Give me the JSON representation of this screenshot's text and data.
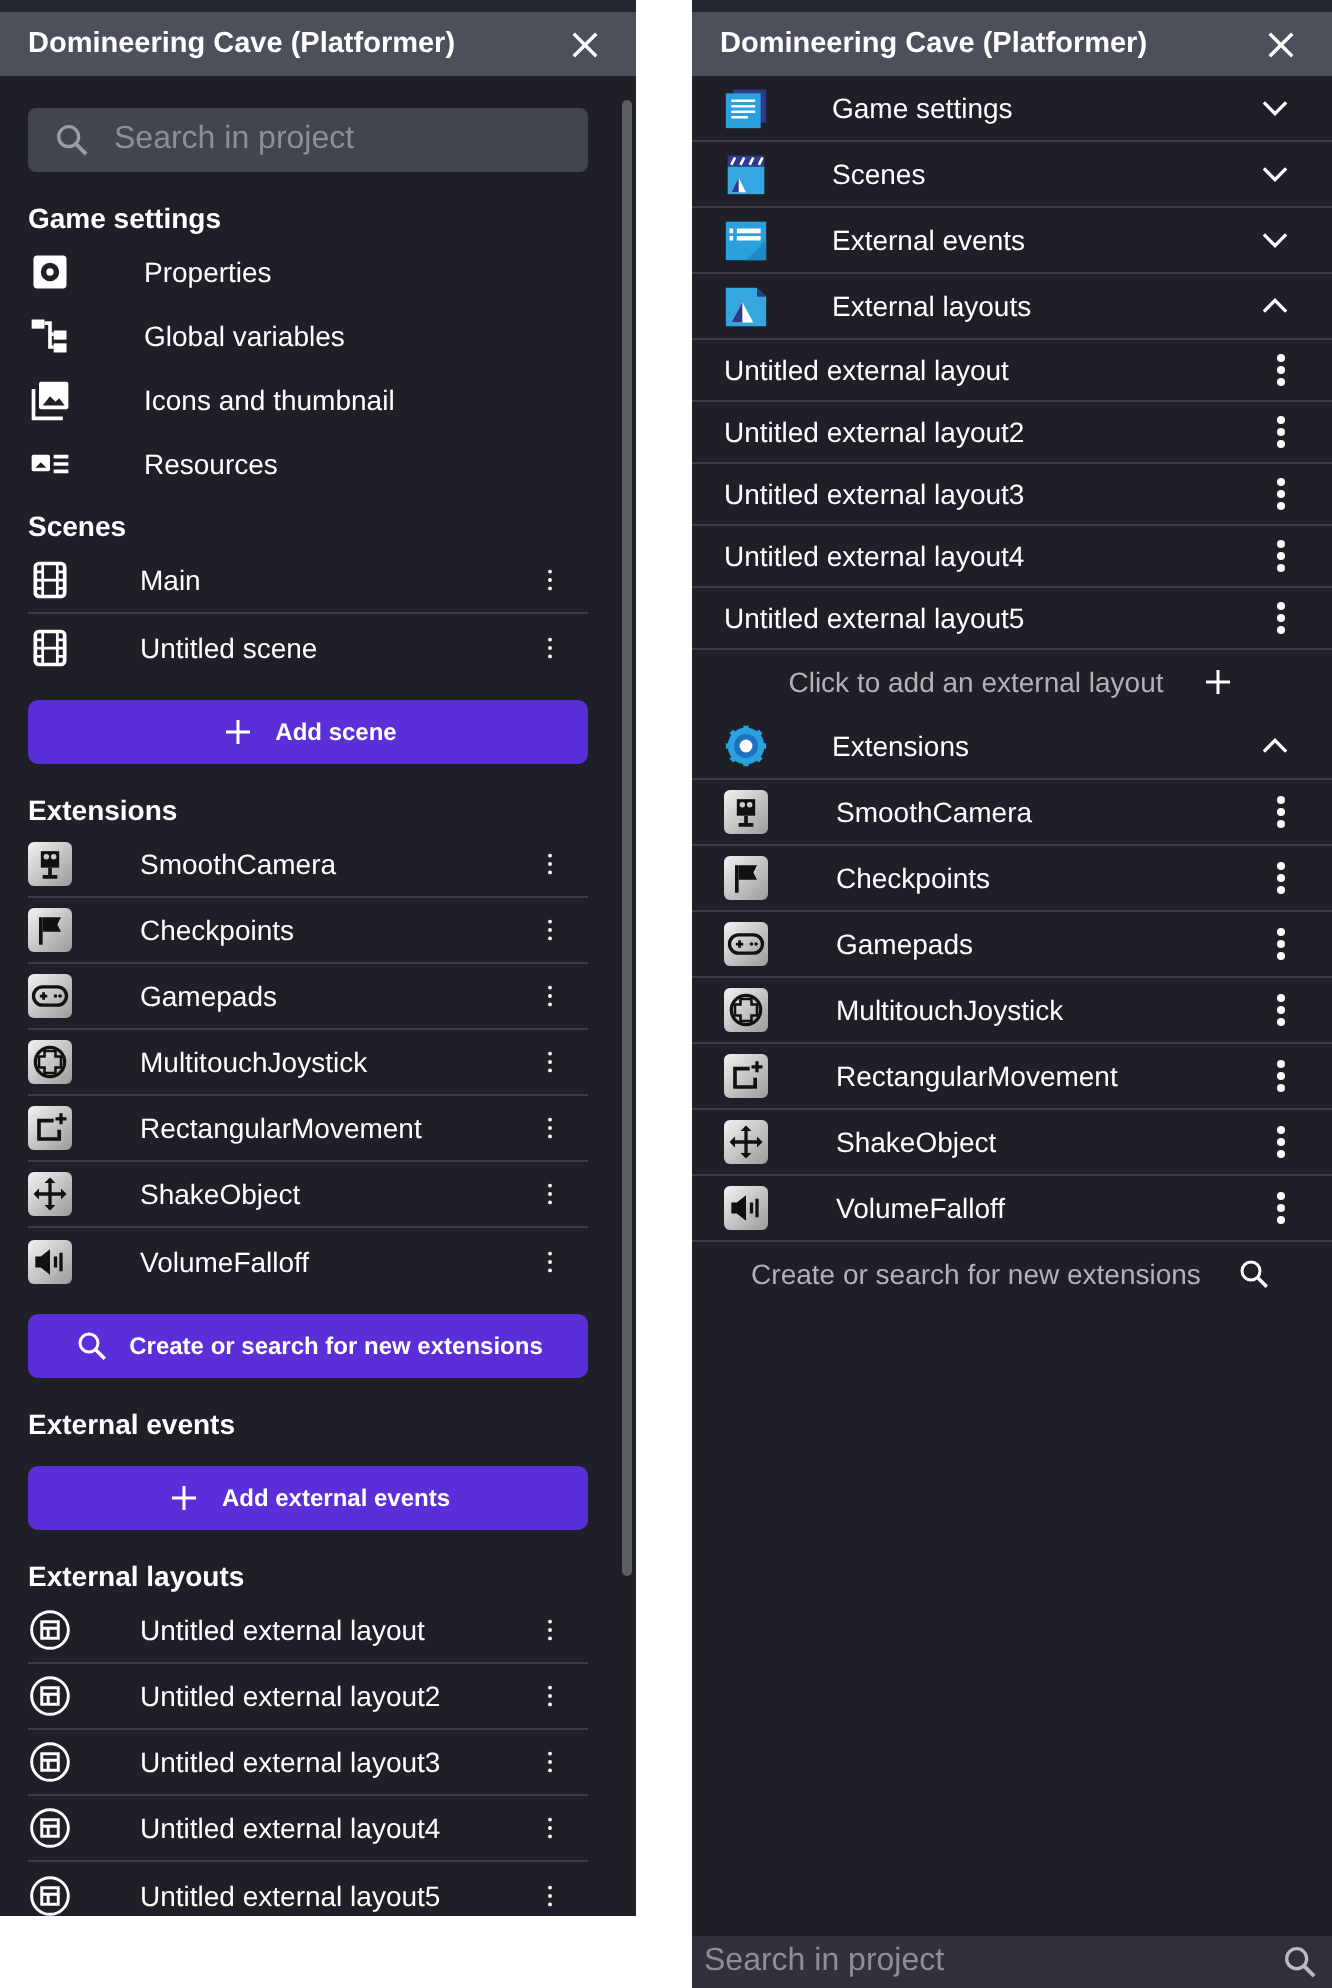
{
  "left_panel": {
    "title": "Domineering Cave (Platformer)",
    "search": {
      "placeholder": "Search in project"
    },
    "sections": [
      {
        "kind": "list",
        "title": "Game settings",
        "items": [
          {
            "label": "Properties"
          },
          {
            "label": "Global variables"
          },
          {
            "label": "Icons and thumbnail"
          },
          {
            "label": "Resources"
          }
        ]
      },
      {
        "kind": "rows",
        "title": "Scenes",
        "items": [
          {
            "label": "Main"
          },
          {
            "label": "Untitled scene"
          }
        ],
        "button": {
          "label": "Add scene"
        }
      },
      {
        "kind": "rows",
        "title": "Extensions",
        "items": [
          {
            "label": "SmoothCamera"
          },
          {
            "label": "Checkpoints"
          },
          {
            "label": "Gamepads"
          },
          {
            "label": "MultitouchJoystick"
          },
          {
            "label": "RectangularMovement"
          },
          {
            "label": "ShakeObject"
          },
          {
            "label": "VolumeFalloff"
          }
        ],
        "button": {
          "label": "Create or search for new extensions"
        }
      },
      {
        "kind": "rows",
        "title": "External events",
        "button": {
          "label": "Add external events"
        }
      },
      {
        "kind": "rows",
        "title": "External layouts",
        "items": [
          {
            "label": "Untitled external layout"
          },
          {
            "label": "Untitled external layout2"
          },
          {
            "label": "Untitled external layout3"
          },
          {
            "label": "Untitled external layout4"
          },
          {
            "label": "Untitled external layout5"
          }
        ]
      }
    ]
  },
  "right_panel": {
    "title": "Domineering Cave (Platformer)",
    "groups": [
      {
        "label": "Game settings",
        "expanded": false
      },
      {
        "label": "Scenes",
        "expanded": false
      },
      {
        "label": "External events",
        "expanded": false
      },
      {
        "label": "External layouts",
        "expanded": true,
        "items": [
          {
            "label": "Untitled external layout"
          },
          {
            "label": "Untitled external layout2"
          },
          {
            "label": "Untitled external layout3"
          },
          {
            "label": "Untitled external layout4"
          },
          {
            "label": "Untitled external layout5"
          }
        ],
        "add": {
          "label": "Click to add an external layout"
        }
      },
      {
        "label": "Extensions",
        "expanded": true,
        "items": [
          {
            "label": "SmoothCamera"
          },
          {
            "label": "Checkpoints"
          },
          {
            "label": "Gamepads"
          },
          {
            "label": "MultitouchJoystick"
          },
          {
            "label": "RectangularMovement"
          },
          {
            "label": "ShakeObject"
          },
          {
            "label": "VolumeFalloff"
          }
        ],
        "add": {
          "label": "Create or search for new extensions"
        }
      }
    ],
    "search": {
      "placeholder": "Search in project"
    }
  }
}
